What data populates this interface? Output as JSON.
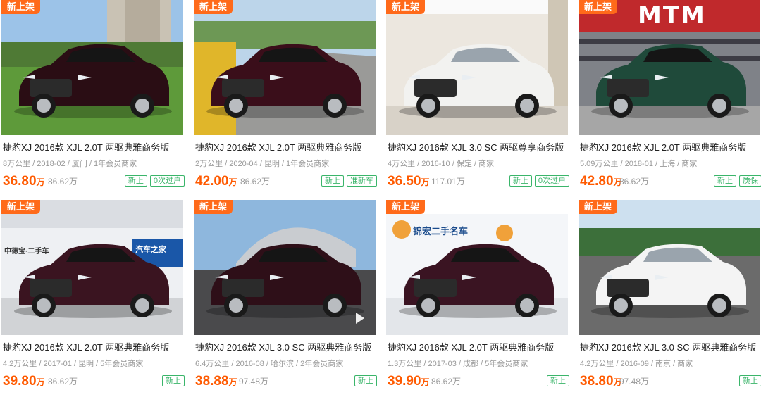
{
  "listings": [
    {
      "tag": "新上架",
      "title": "捷豹XJ 2016款 XJL 2.0T 两驱典雅商务版",
      "meta": "8万公里 / 2018-02 / 厦门 / 1年会员商家",
      "price": "36.80",
      "unit": "万",
      "old_price": "86.62万",
      "badges": [
        "新上",
        "0次过户"
      ],
      "car_color": "#2a0d14",
      "scene": "grass"
    },
    {
      "tag": "新上架",
      "title": "捷豹XJ 2016款 XJL 2.0T 两驱典雅商务版",
      "meta": "2万公里 / 2020-04 / 昆明 / 1年会员商家",
      "price": "42.00",
      "unit": "万",
      "old_price": "86.62万",
      "badges": [
        "新上",
        "准新车"
      ],
      "car_color": "#3a0e1a",
      "scene": "road"
    },
    {
      "tag": "新上架",
      "title": "捷豹XJ 2016款 XJL 3.0 SC 两驱尊享商务版",
      "meta": "4万公里 / 2016-10 / 保定 / 商家",
      "price": "36.50",
      "unit": "万",
      "old_price": "117.01万",
      "badges": [
        "新上",
        "0次过户"
      ],
      "car_color": "#f2f2f0",
      "scene": "showroom"
    },
    {
      "tag": "新上架",
      "title": "捷豹XJ 2016款 XJL 2.0T 两驱典雅商务版",
      "meta": "5.09万公里 / 2018-01 / 上海 / 商家",
      "price": "42.80",
      "unit": "万",
      "old_price": "86.62万",
      "badges": [
        "新上",
        "质保"
      ],
      "car_color": "#1f4a3a",
      "scene": "garage",
      "sign": "MTM"
    },
    {
      "tag": "新上架",
      "title": "捷豹XJ 2016款 XJL 2.0T 两驱典雅商务版",
      "meta": "4.2万公里 / 2017-01 / 昆明 / 5年会员商家",
      "price": "39.80",
      "unit": "万",
      "old_price": "86.62万",
      "badges": [
        "新上"
      ],
      "car_color": "#3a1420",
      "scene": "indoor",
      "wall_text": "中德宝·二手车",
      "banner_text": "汽车之家"
    },
    {
      "tag": "新上架",
      "title": "捷豹XJ 2016款 XJL 3.0 SC 两驱典雅商务版",
      "meta": "6.4万公里 / 2016-08 / 哈尔滨 / 2年会员商家",
      "price": "38.88",
      "unit": "万",
      "old_price": "97.48万",
      "badges": [
        "新上"
      ],
      "car_color": "#2e0f18",
      "scene": "stadium"
    },
    {
      "tag": "新上架",
      "title": "捷豹XJ 2016款 XJL 2.0T 两驱典雅商务版",
      "meta": "1.3万公里 / 2017-03 / 成都 / 5年会员商家",
      "price": "39.90",
      "unit": "万",
      "old_price": "86.62万",
      "badges": [
        "新上"
      ],
      "car_color": "#3a1422",
      "scene": "studio",
      "wall_text": "锦宏二手名车"
    },
    {
      "tag": "新上架",
      "title": "捷豹XJ 2016款 XJL 3.0 SC 两驱典雅商务版",
      "meta": "4.2万公里 / 2016-09 / 南京 / 商家",
      "price": "38.80",
      "unit": "万",
      "old_price": "97.48万",
      "badges": [
        "新上"
      ],
      "car_color": "#f4f4f4",
      "scene": "street"
    }
  ]
}
